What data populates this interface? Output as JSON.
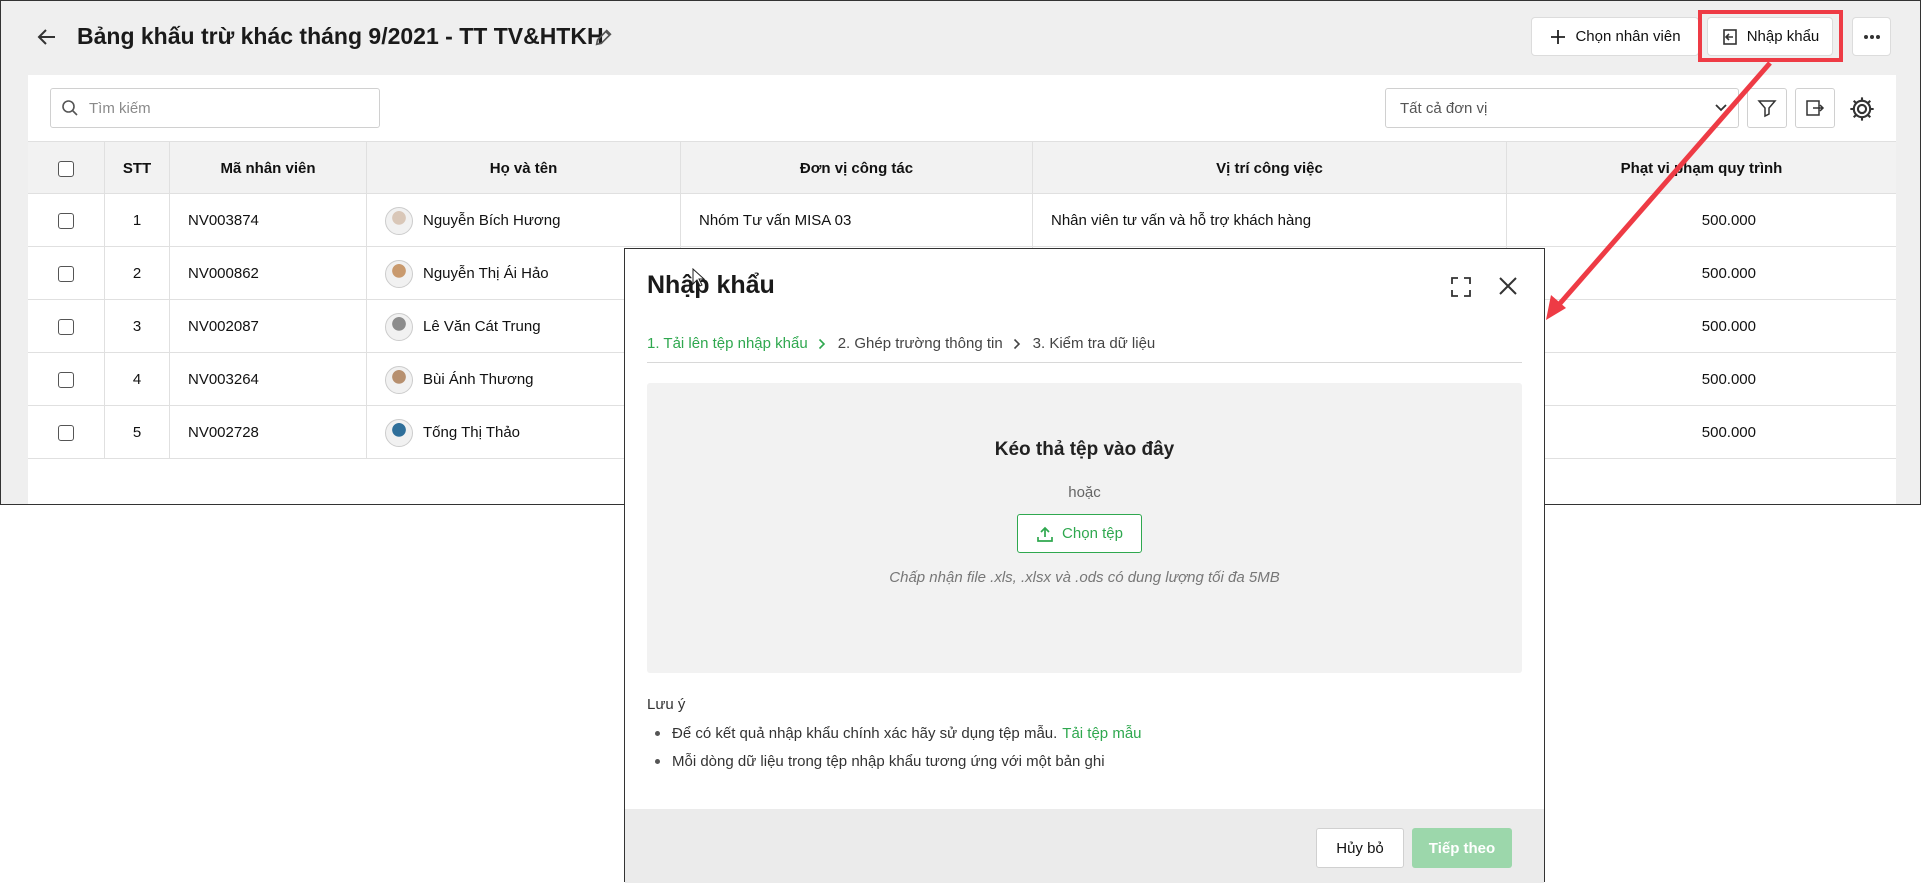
{
  "header": {
    "title": "Bảng khấu trừ khác tháng 9/2021 - TT TV&HTKH",
    "choose_employee_label": "Chọn nhân viên",
    "import_label": "Nhập khẩu"
  },
  "toolbar": {
    "search_placeholder": "Tìm kiếm",
    "unit_filter_value": "Tất cả đơn vị"
  },
  "table": {
    "columns": [
      "STT",
      "Mã nhân viên",
      "Họ và tên",
      "Đơn vị công tác",
      "Vị trí công việc",
      "Phạt vi phạm quy trình"
    ],
    "rows": [
      {
        "stt": "1",
        "code": "NV003874",
        "name": "Nguyễn Bích Hương",
        "unit": "Nhóm Tư vấn MISA 03",
        "position": "Nhân viên tư vấn và hỗ trợ khách hàng",
        "fine": "500.000",
        "avatar_color": "#d9c7b8"
      },
      {
        "stt": "2",
        "code": "NV000862",
        "name": "Nguyễn Thị Ái Hảo",
        "unit": "",
        "position": "",
        "fine": "500.000",
        "avatar_color": "#c99a6e"
      },
      {
        "stt": "3",
        "code": "NV002087",
        "name": "Lê Văn Cát Trung",
        "unit": "",
        "position": "",
        "fine": "500.000",
        "avatar_color": "#8c8c8c"
      },
      {
        "stt": "4",
        "code": "NV003264",
        "name": "Bùi Ánh Thương",
        "unit": "",
        "position": "",
        "fine": "500.000",
        "avatar_color": "#b7906f"
      },
      {
        "stt": "5",
        "code": "NV002728",
        "name": "Tống Thị Thảo",
        "unit": "",
        "position": "",
        "fine": "500.000",
        "avatar_color": "#2f6f9a"
      }
    ]
  },
  "dialog": {
    "title": "Nhập khẩu",
    "steps": [
      "1. Tải lên tệp nhập khẩu",
      "2. Ghép trường thông tin",
      "3. Kiểm tra dữ liệu"
    ],
    "dropzone_title": "Kéo thả tệp vào đây",
    "dropzone_or": "hoặc",
    "choose_file_label": "Chọn tệp",
    "dropzone_hint": "Chấp nhận file .xls, .xlsx và .ods có dung lượng tối đa 5MB",
    "note_title": "Lưu ý",
    "note_1": "Để có kết quả nhập khẩu chính xác hãy sử dụng tệp mẫu.",
    "note_1_link": "Tải tệp mẫu",
    "note_2": "Mỗi dòng dữ liệu trong tệp nhập khẩu tương ứng với một bản ghi",
    "cancel_label": "Hủy bỏ",
    "next_label": "Tiếp theo"
  },
  "colors": {
    "accent_green": "#2fa84f",
    "highlight_red": "#ee3b45",
    "next_disabled": "#9cd7ab"
  }
}
